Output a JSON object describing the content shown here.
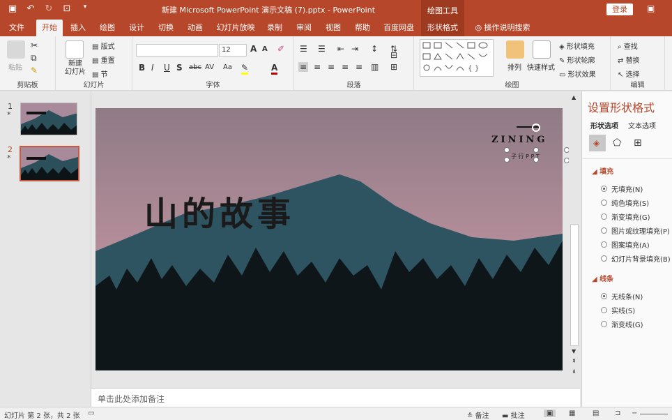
{
  "titlebar": {
    "qat_icons": [
      "save-icon",
      "undo-icon",
      "redo-icon",
      "start-from-beginning-icon",
      "customize-icon"
    ],
    "doc_title": "新建 Microsoft PowerPoint 演示文稿 (7).pptx  -  PowerPoint",
    "context_tool": "绘图工具",
    "login": "登录",
    "window_icon": "ribbon-display-icon"
  },
  "tabs": [
    "文件",
    "开始",
    "插入",
    "绘图",
    "设计",
    "切换",
    "动画",
    "幻灯片放映",
    "录制",
    "审阅",
    "视图",
    "帮助",
    "百度网盘",
    "形状格式"
  ],
  "tell_me": "操作说明搜索",
  "ribbon": {
    "clipboard": {
      "paste": "粘贴",
      "label": "剪贴板"
    },
    "slides": {
      "new_slide": "新建\n幻灯片",
      "layout": "版式",
      "reset": "重置",
      "section": "节",
      "label": "幻灯片"
    },
    "font": {
      "font_name": "",
      "font_size": "12",
      "label": "字体",
      "buttons": [
        "B",
        "I",
        "U",
        "S",
        "abc",
        "AV",
        "Aa",
        "A"
      ]
    },
    "paragraph": {
      "label": "段落"
    },
    "drawing": {
      "arrange": "排列",
      "quick_styles": "快速样式",
      "fill": "形状填充",
      "outline": "形状轮廓",
      "effects": "形状效果",
      "label": "绘图"
    },
    "editing": {
      "find": "查找",
      "replace": "替换",
      "select": "选择",
      "label": "编辑"
    }
  },
  "thumbnails": [
    {
      "num": "1",
      "star": "*"
    },
    {
      "num": "2",
      "star": "*"
    }
  ],
  "slide": {
    "title": "山的故事",
    "brand": "ZINING",
    "brand_sub": "子 行 P P T"
  },
  "notes_placeholder": "单击此处添加备注",
  "pane": {
    "title": "设置形状格式",
    "tab_shape": "形状选项",
    "tab_text": "文本选项",
    "fill_header": "填充",
    "fill_options": [
      {
        "label": "无填充(N)",
        "checked": true
      },
      {
        "label": "纯色填充(S)",
        "checked": false
      },
      {
        "label": "渐变填充(G)",
        "checked": false
      },
      {
        "label": "图片或纹理填充(P)",
        "checked": false
      },
      {
        "label": "图案填充(A)",
        "checked": false
      },
      {
        "label": "幻灯片背景填充(B)",
        "checked": false
      }
    ],
    "line_header": "线条",
    "line_options": [
      {
        "label": "无线条(N)",
        "checked": true
      },
      {
        "label": "实线(S)",
        "checked": false
      },
      {
        "label": "渐变线(G)",
        "checked": false
      }
    ]
  },
  "status": {
    "slide_info": "幻灯片 第 2 张，共 2 张",
    "notes": "备注",
    "comments": "批注"
  },
  "colors": {
    "accent": "#b7472a",
    "sky": "#a88a9a",
    "mountain": "#2c4f5c"
  }
}
